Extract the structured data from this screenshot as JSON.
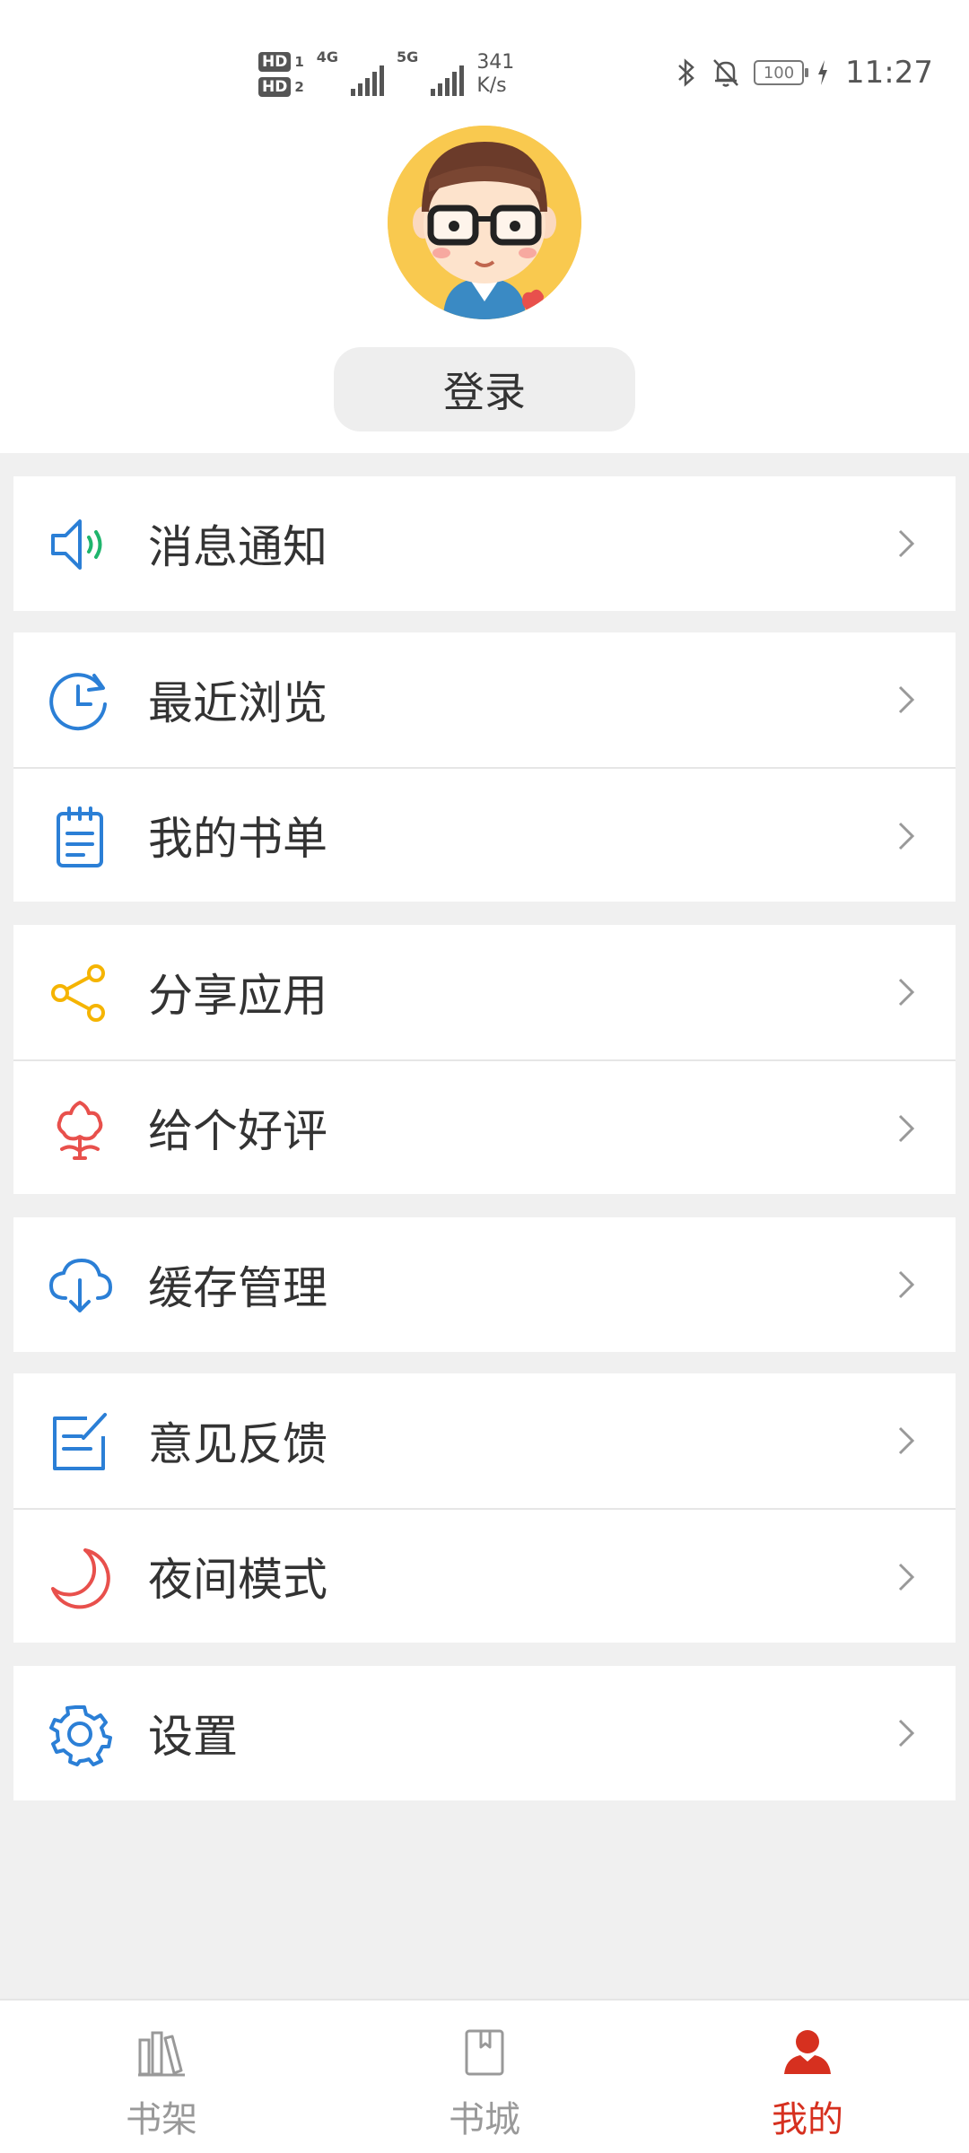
{
  "status_bar": {
    "hd1": "HD",
    "hd1_num": "1",
    "hd2": "HD",
    "hd2_num": "2",
    "net1": "4G",
    "net2": "5G",
    "speed_value": "341",
    "speed_unit": "K/s",
    "battery": "100",
    "time": "11:27"
  },
  "profile": {
    "login_label": "登录"
  },
  "menu": {
    "groups": [
      {
        "items": [
          {
            "label": "消息通知",
            "icon": "speaker-icon",
            "color": "#2b7fd6"
          }
        ]
      },
      {
        "items": [
          {
            "label": "最近浏览",
            "icon": "clock-history-icon",
            "color": "#2b7fd6"
          },
          {
            "label": "我的书单",
            "icon": "notepad-icon",
            "color": "#2b7fd6"
          }
        ]
      },
      {
        "items": [
          {
            "label": "分享应用",
            "icon": "share-icon",
            "color": "#f5b400"
          },
          {
            "label": "给个好评",
            "icon": "flower-icon",
            "color": "#e8504c"
          }
        ]
      },
      {
        "items": [
          {
            "label": "缓存管理",
            "icon": "cloud-download-icon",
            "color": "#2b7fd6"
          }
        ]
      },
      {
        "items": [
          {
            "label": "意见反馈",
            "icon": "feedback-edit-icon",
            "color": "#2b7fd6"
          },
          {
            "label": "夜间模式",
            "icon": "moon-icon",
            "color": "#e8504c"
          }
        ]
      },
      {
        "items": [
          {
            "label": "设置",
            "icon": "gear-icon",
            "color": "#2b7fd6"
          }
        ]
      }
    ]
  },
  "bottom_nav": {
    "tabs": [
      {
        "label": "书架",
        "icon": "bookshelf-icon",
        "active": false
      },
      {
        "label": "书城",
        "icon": "book-icon",
        "active": false
      },
      {
        "label": "我的",
        "icon": "person-icon",
        "active": true
      }
    ],
    "active_color": "#d6301f",
    "inactive_color": "#999999"
  }
}
